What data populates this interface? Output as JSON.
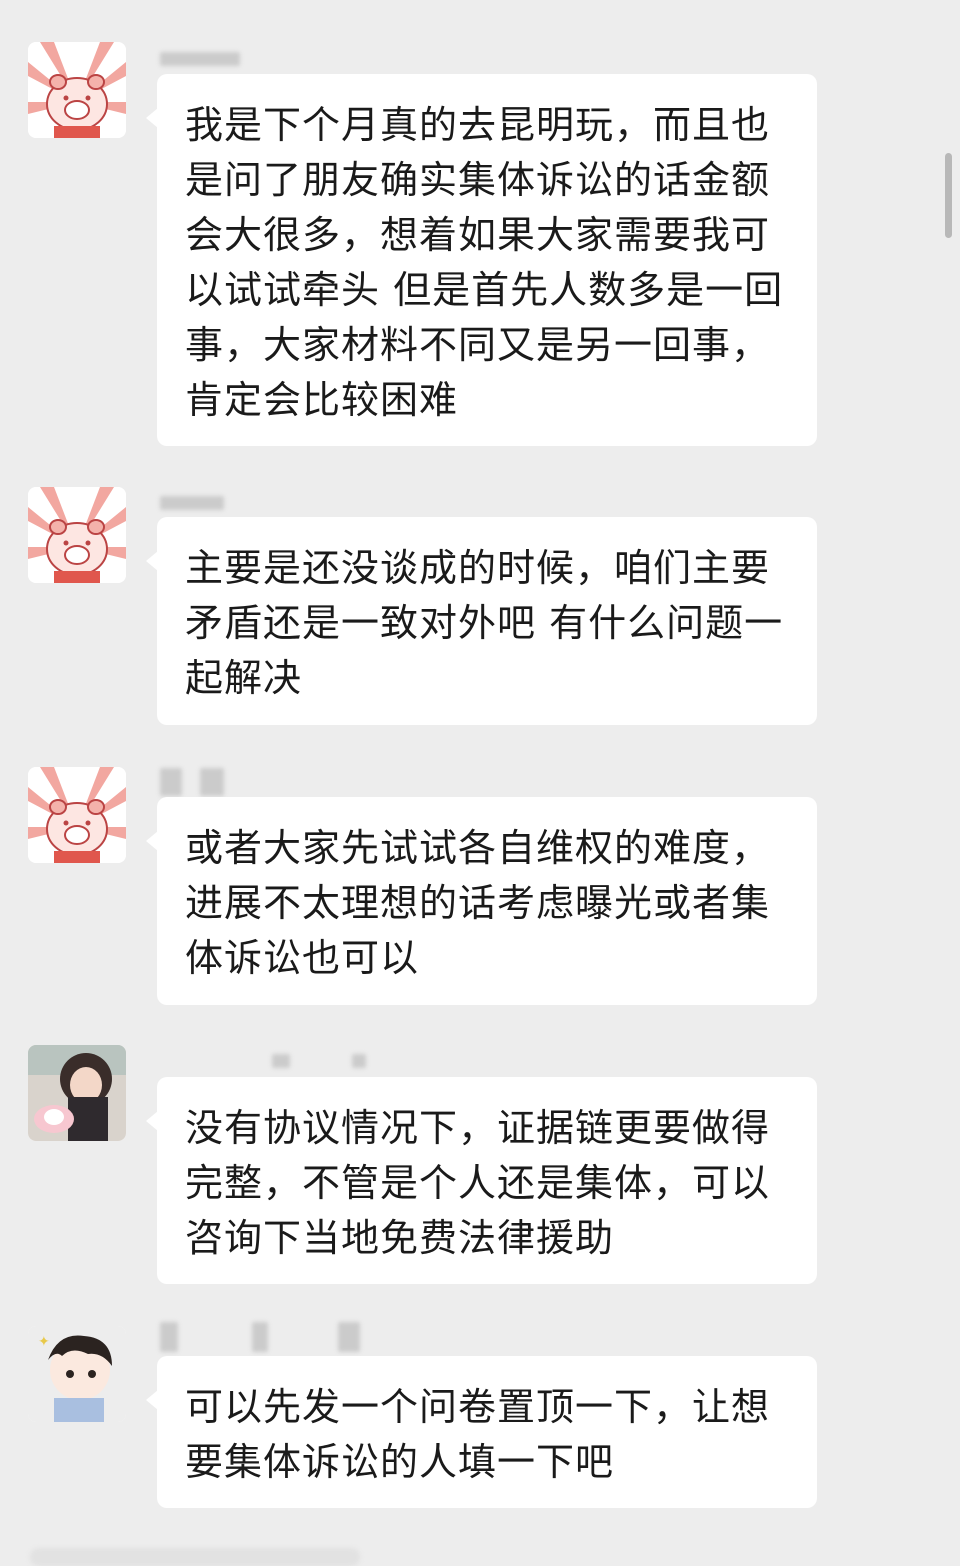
{
  "messages": [
    {
      "avatar": "pig-avatar",
      "text": "我是下个月真的去昆明玩，而且也是问了朋友确实集体诉讼的话金额会大很多，想着如果大家需要我可以试试牵头 但是首先人数多是一回事，大家材料不同又是另一回事，肯定会比较困难"
    },
    {
      "avatar": "pig-avatar",
      "text": "主要是还没谈成的时候，咱们主要矛盾还是一致对外吧 有什么问题一起解决"
    },
    {
      "avatar": "pig-avatar",
      "text": "或者大家先试试各自维权的难度，进展不太理想的话考虑曝光或者集体诉讼也可以"
    },
    {
      "avatar": "girl-photo-avatar",
      "text": "没有协议情况下，证据链更要做得完整，不管是个人还是集体，可以咨询下当地免费法律援助"
    },
    {
      "avatar": "cartoon-boy-avatar",
      "text": "可以先发一个问卷置顶一下，让想要集体诉讼的人填一下吧"
    }
  ]
}
